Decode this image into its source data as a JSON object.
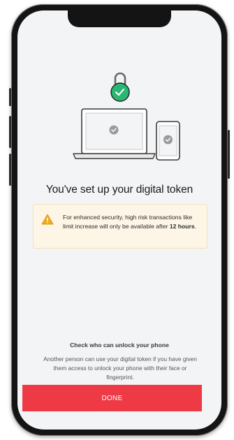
{
  "screen": {
    "title": "You've set up your digital token",
    "warning": {
      "icon": "warning-triangle-icon",
      "text_before": "For enhanced security, high risk transactions like limit increase will only be available after ",
      "text_bold": "12 hours",
      "text_after": "."
    },
    "check": {
      "title": "Check who can unlock your phone",
      "body": "Another person can use your digital token if you have given them access to unlock your phone with their face or fingerprint."
    },
    "done_label": "DONE"
  },
  "illustration": {
    "icons": [
      "lock-icon",
      "laptop-icon",
      "phone-icon",
      "check-icon"
    ]
  },
  "colors": {
    "accent_red": "#ee3a45",
    "success_green": "#2bb673",
    "warning_bg": "#fdf6e6",
    "warning_icon": "#f0a81c"
  }
}
